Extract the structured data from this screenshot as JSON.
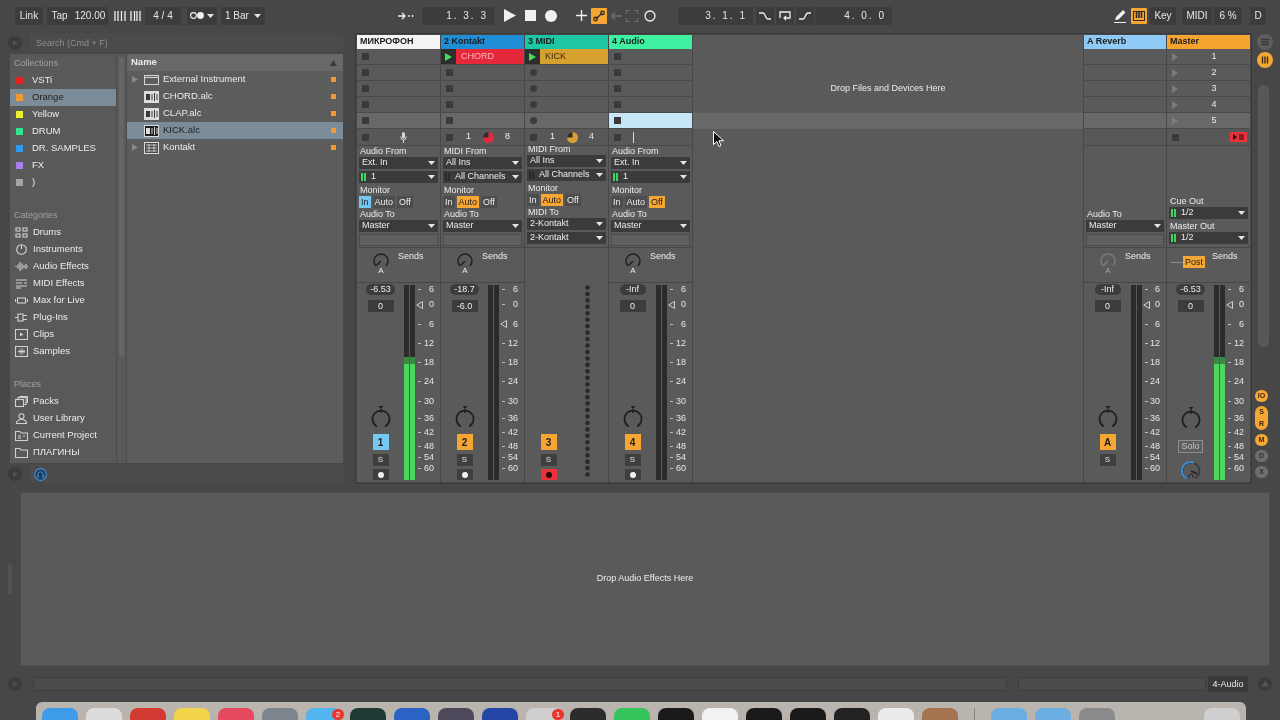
{
  "transport": {
    "link": "Link",
    "tap": "Tap",
    "tempo": "120.00",
    "signature": "4 / 4",
    "quantization": "1 Bar",
    "position": "1. 3. 3",
    "automation_arm": {
      "on": true
    },
    "loop_start": "3. 1. 1",
    "loop_length": "4. 0. 0"
  },
  "status_controls": {
    "keyboard": {
      "on": true
    },
    "key": "Key",
    "midi": "MIDI",
    "cpu": "6 %",
    "disk": "D"
  },
  "browser": {
    "search": {
      "placeholder": "Search (Cmd + F)"
    },
    "sections": [
      {
        "title": "Collections",
        "items": [
          {
            "label": "VSTi",
            "color": "#e2231f",
            "selected": false
          },
          {
            "label": "Orange",
            "color": "#f39a32",
            "selected": true
          },
          {
            "label": "Yellow",
            "color": "#eef032",
            "selected": false
          },
          {
            "label": "DRUM",
            "color": "#33e58f",
            "selected": false
          },
          {
            "label": "DR. SAMPLES",
            "color": "#2e9df0",
            "selected": false
          },
          {
            "label": "FX",
            "color": "#a97ef0",
            "selected": false
          },
          {
            "label": ")",
            "color": "#a5a5a5",
            "selected": false
          }
        ]
      },
      {
        "title": "Categories",
        "items": [
          {
            "label": "Drums",
            "selected": false
          },
          {
            "label": "Instruments",
            "selected": false
          },
          {
            "label": "Audio Effects",
            "selected": false
          },
          {
            "label": "MIDI Effects",
            "selected": false
          },
          {
            "label": "Max for Live",
            "selected": false
          },
          {
            "label": "Plug-Ins",
            "selected": false
          },
          {
            "label": "Clips",
            "selected": false
          },
          {
            "label": "Samples",
            "selected": false
          }
        ]
      },
      {
        "title": "Places",
        "items": [
          {
            "label": "Packs",
            "selected": false
          },
          {
            "label": "User Library",
            "selected": false
          },
          {
            "label": "Current Project",
            "selected": false
          },
          {
            "label": "ПЛАГИНЫ",
            "selected": false
          }
        ]
      }
    ],
    "list_header": "Name",
    "files": [
      {
        "name": "External Instrument",
        "kind": "device",
        "expandable": true,
        "selected": false,
        "color": "#f39a32"
      },
      {
        "name": "CHORD.alc",
        "kind": "clip",
        "expandable": false,
        "selected": false,
        "color": "#f39a32"
      },
      {
        "name": "CLAP.alc",
        "kind": "clip",
        "expandable": false,
        "selected": false,
        "color": "#f39a32"
      },
      {
        "name": "KICK.alc",
        "kind": "clip",
        "expandable": false,
        "selected": true,
        "color": "#f39a32"
      },
      {
        "name": "Kontakt",
        "kind": "plugin",
        "expandable": true,
        "selected": false,
        "color": "#f39a32"
      }
    ]
  },
  "session": {
    "drop_hint": "Drop Files and Devices Here",
    "tracks": [
      {
        "name": "МИКРОФОН",
        "selected": true,
        "slots": [
          {
            "kind": "stop",
            "selected": false
          },
          {
            "kind": "stop",
            "selected": false
          },
          {
            "kind": "stop",
            "selected": false
          },
          {
            "kind": "stop",
            "selected": false
          },
          {
            "kind": "stop",
            "selected": false
          }
        ],
        "stop_row": {
          "kind": "mic"
        },
        "io": [
          {
            "kind": "label",
            "text": "Audio From"
          },
          {
            "kind": "dropdown",
            "value": "Ext. In"
          },
          {
            "kind": "channel",
            "value": "1",
            "active": true
          },
          {
            "kind": "label",
            "text": "Monitor"
          },
          {
            "kind": "monitor",
            "options": [
              {
                "label": "In",
                "selected": true
              },
              {
                "label": "Auto",
                "selected": false
              },
              {
                "label": "Off",
                "selected": false
              }
            ]
          },
          {
            "kind": "label",
            "text": "Audio To"
          },
          {
            "kind": "dropdown",
            "value": "Master"
          },
          {
            "kind": "field"
          }
        ],
        "sends": {
          "kind": "knob",
          "knob_label": "A",
          "label": "Sends",
          "disabled": false
        },
        "mixer": {
          "kind": "track",
          "peak": "-6.53",
          "volume": "0",
          "meter": {
            "level": 0.63
          },
          "fader": {
            "level": 0.89
          },
          "scale": [
            "6",
            "0",
            "6",
            "12",
            "18",
            "24",
            "30",
            "36",
            "42",
            "48",
            "54",
            "60"
          ],
          "activator": "1",
          "solo": "S",
          "arm": {
            "armed": false
          }
        }
      },
      {
        "name": "2 Kontakt",
        "color": "#1f8ed6",
        "selected": false,
        "slots": [
          {
            "kind": "clip",
            "name": "CHORD",
            "color": "#e5283a",
            "playing": true,
            "selected": false
          },
          {
            "kind": "stop",
            "selected": false
          },
          {
            "kind": "stop",
            "selected": false
          },
          {
            "kind": "stop",
            "selected": false
          },
          {
            "kind": "stop",
            "selected": false
          }
        ],
        "stop_row": {
          "kind": "counter",
          "current": "1",
          "total": "8",
          "color": "#e5283a"
        },
        "io": [
          {
            "kind": "label",
            "text": "MIDI From"
          },
          {
            "kind": "dropdown",
            "value": "All Ins"
          },
          {
            "kind": "channel",
            "value": "All Channels",
            "active": false
          },
          {
            "kind": "label",
            "text": "Monitor"
          },
          {
            "kind": "monitor",
            "options": [
              {
                "label": "In",
                "selected": false
              },
              {
                "label": "Auto",
                "selected": true
              },
              {
                "label": "Off",
                "selected": false
              }
            ]
          },
          {
            "kind": "label",
            "text": "Audio To"
          },
          {
            "kind": "dropdown",
            "value": "Master"
          },
          {
            "kind": "field"
          }
        ],
        "sends": {
          "kind": "knob",
          "knob_label": "A",
          "label": "Sends",
          "disabled": false
        },
        "mixer": {
          "kind": "track",
          "peak": "-18.7",
          "volume": "-6.0",
          "fader": {
            "level": 0.79
          },
          "scale": [
            "6",
            "0",
            "6",
            "12",
            "18",
            "24",
            "30",
            "36",
            "42",
            "48",
            "54",
            "60"
          ],
          "activator": "2",
          "solo": "S",
          "arm": {
            "armed": false
          }
        }
      },
      {
        "name": "3 MIDI",
        "color": "#1fc6a6",
        "selected": false,
        "slots": [
          {
            "kind": "clip",
            "name": "KICK",
            "color": "#d6a12f",
            "playing": true,
            "selected": false
          },
          {
            "kind": "record",
            "selected": false
          },
          {
            "kind": "record",
            "selected": false
          },
          {
            "kind": "record",
            "selected": false
          },
          {
            "kind": "record",
            "selected": false
          }
        ],
        "stop_row": {
          "kind": "counter",
          "current": "1",
          "total": "4",
          "color": "#d6a12f"
        },
        "io": [
          {
            "kind": "label",
            "text": "MIDI From"
          },
          {
            "kind": "dropdown",
            "value": "All Ins"
          },
          {
            "kind": "channel",
            "value": "All Channels",
            "active": false
          },
          {
            "kind": "label",
            "text": "Monitor"
          },
          {
            "kind": "monitor",
            "options": [
              {
                "label": "In",
                "selected": false
              },
              {
                "label": "Auto",
                "selected": true
              },
              {
                "label": "Off",
                "selected": false
              }
            ]
          },
          {
            "kind": "label",
            "text": "MIDI To"
          },
          {
            "kind": "dropdown",
            "value": "2-Kontakt"
          },
          {
            "kind": "dropdown",
            "value": "2-Kontakt"
          }
        ],
        "mixer": {
          "kind": "midi",
          "activator": "3",
          "solo": "S",
          "arm": {
            "armed": true
          }
        }
      },
      {
        "name": "4 Audio",
        "color": "#3ff0a0",
        "selected": false,
        "slots": [
          {
            "kind": "stop",
            "selected": false
          },
          {
            "kind": "stop",
            "selected": false
          },
          {
            "kind": "stop",
            "selected": false
          },
          {
            "kind": "stop",
            "selected": false
          },
          {
            "kind": "stop",
            "selected": true
          }
        ],
        "stop_row": {
          "kind": "line"
        },
        "io": [
          {
            "kind": "label",
            "text": "Audio From"
          },
          {
            "kind": "dropdown",
            "value": "Ext. In"
          },
          {
            "kind": "channel",
            "value": "1",
            "active": true
          },
          {
            "kind": "label",
            "text": "Monitor"
          },
          {
            "kind": "monitor",
            "options": [
              {
                "label": "In",
                "selected": false
              },
              {
                "label": "Auto",
                "selected": false
              },
              {
                "label": "Off",
                "selected": true
              }
            ]
          },
          {
            "kind": "label",
            "text": "Audio To"
          },
          {
            "kind": "dropdown",
            "value": "Master"
          },
          {
            "kind": "field"
          }
        ],
        "sends": {
          "kind": "knob",
          "knob_label": "A",
          "label": "Sends",
          "disabled": false
        },
        "mixer": {
          "kind": "track",
          "peak": "-Inf",
          "volume": "0",
          "fader": {
            "level": 0.89
          },
          "scale": [
            "6",
            "0",
            "6",
            "12",
            "18",
            "24",
            "30",
            "36",
            "42",
            "48",
            "54",
            "60"
          ],
          "activator": "4",
          "solo": "S",
          "arm": {
            "armed": false
          }
        }
      }
    ],
    "returns": [
      {
        "name": "A Reverb",
        "color": "#8fc9f5",
        "selected": false,
        "slots": [
          {
            "selected": false
          },
          {
            "selected": false
          },
          {
            "selected": false
          },
          {
            "selected": false
          },
          {
            "selected": false
          }
        ],
        "io": [
          {
            "kind": "label",
            "text": "Audio To"
          },
          {
            "kind": "dropdown",
            "value": "Master"
          },
          {
            "kind": "field"
          }
        ],
        "sends": {
          "kind": "knob",
          "knob_label": "A",
          "label": "Sends",
          "disabled": true
        },
        "mixer": {
          "kind": "return",
          "peak": "-Inf",
          "volume": "0",
          "fader": {
            "level": 0.89
          },
          "scale": [
            "6",
            "0",
            "6",
            "12",
            "18",
            "24",
            "30",
            "36",
            "42",
            "48",
            "54",
            "60"
          ],
          "activator": "A",
          "solo": "S"
        }
      }
    ],
    "master": {
      "name": "Master",
      "color": "#f5a431",
      "selected": false,
      "scenes": [
        {
          "number": "1",
          "selected": false
        },
        {
          "number": "2",
          "selected": false
        },
        {
          "number": "3",
          "selected": false
        },
        {
          "number": "4",
          "selected": false
        },
        {
          "number": "5",
          "selected": true
        }
      ],
      "stop_row": {
        "kind": "stop_all"
      },
      "io": [
        {
          "kind": "label",
          "text": "Cue Out"
        },
        {
          "kind": "channel",
          "value": "1/2",
          "active": true
        },
        {
          "kind": "label",
          "text": "Master Out"
        },
        {
          "kind": "channel",
          "value": "1/2",
          "active": true
        }
      ],
      "sends": {
        "kind": "post",
        "button": "Post",
        "label": "Sends"
      },
      "mixer": {
        "kind": "master",
        "peak": "-6.53",
        "volume": "0",
        "meter": {
          "level": 0.63
        },
        "fader": {
          "level": 0.89
        },
        "scale": [
          "6",
          "0",
          "6",
          "12",
          "18",
          "24",
          "30",
          "36",
          "42",
          "48",
          "54",
          "60"
        ],
        "solo_switch": {
          "label": "Solo",
          "disabled": true
        }
      }
    }
  },
  "view_toggles": [
    {
      "label": "IO",
      "kind": "single",
      "on": true
    },
    {
      "label": "S",
      "kind": "top",
      "on": true
    },
    {
      "label": "R",
      "kind": "bottom",
      "on": true
    },
    {
      "label": "M",
      "kind": "single",
      "on": true
    },
    {
      "label": "D",
      "kind": "single",
      "on": false
    },
    {
      "label": "X",
      "kind": "single",
      "on": false
    }
  ],
  "device_view": {
    "drop_hint": "Drop Audio Effects Here"
  },
  "status_bar": {
    "selected_track": "4-Audio"
  },
  "dock": {
    "apps": [
      {
        "color": "#3d9be9"
      },
      {
        "color": "#dcdcdc"
      },
      {
        "color": "#d33a32"
      },
      {
        "color": "#f2d34a"
      },
      {
        "color": "#e5495f"
      },
      {
        "color": "#7d858d"
      },
      {
        "color": "#52b5f0",
        "badge": "2"
      },
      {
        "color": "#1e3b36"
      },
      {
        "color": "#2b63c4"
      },
      {
        "color": "#4e4a5c"
      },
      {
        "color": "#2447a6"
      },
      {
        "color": "#cfcfcf",
        "badge": "1"
      },
      {
        "color": "#2c2c2c"
      },
      {
        "color": "#35c45a"
      },
      {
        "color": "#1b1b1b"
      },
      {
        "color": "#f2f2f2"
      },
      {
        "color": "#1b1b1b"
      },
      {
        "color": "#1b1b1b"
      },
      {
        "color": "#222222"
      },
      {
        "color": "#ebebeb"
      },
      {
        "color": "#a5734f"
      }
    ],
    "stacks": [
      {
        "color": "#6aaee3"
      },
      {
        "color": "#6aaee3"
      },
      {
        "color": "#8a8a8a"
      },
      {
        "color": "#cfcfcf"
      }
    ]
  }
}
